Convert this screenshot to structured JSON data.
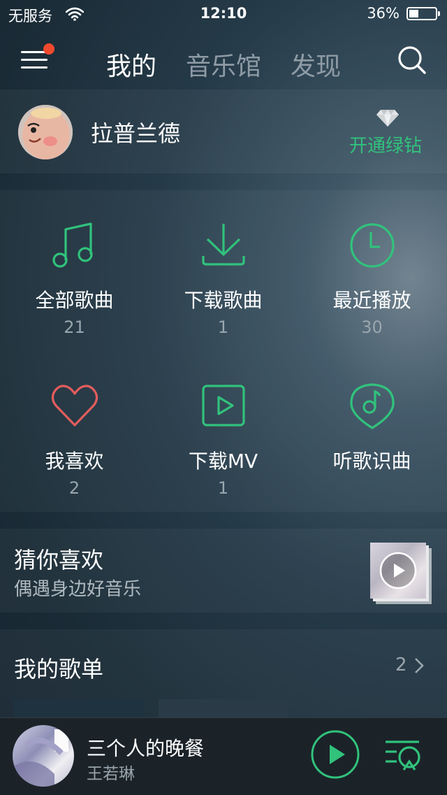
{
  "status_bar": {
    "carrier": "无服务",
    "time": "12:10",
    "battery": "36%",
    "battery_level": 0.36
  },
  "nav": {
    "tabs": [
      {
        "label": "我的",
        "active": true
      },
      {
        "label": "音乐馆",
        "active": false
      },
      {
        "label": "发现",
        "active": false
      }
    ]
  },
  "profile": {
    "username": "拉普兰德",
    "vip_label": "开通绿钻"
  },
  "grid": [
    {
      "label": "全部歌曲",
      "count": "21",
      "icon": "music-note-icon"
    },
    {
      "label": "下载歌曲",
      "count": "1",
      "icon": "download-icon"
    },
    {
      "label": "最近播放",
      "count": "30",
      "icon": "clock-icon"
    },
    {
      "label": "我喜欢",
      "count": "2",
      "icon": "heart-icon"
    },
    {
      "label": "下载MV",
      "count": "1",
      "icon": "video-icon"
    },
    {
      "label": "听歌识曲",
      "count": "",
      "icon": "music-recognition-icon"
    }
  ],
  "guess": {
    "title": "猜你喜欢",
    "subtitle": "偶遇身边好音乐"
  },
  "playlists": {
    "title": "我的歌单",
    "count": "2"
  },
  "player": {
    "song": "三个人的晚餐",
    "artist": "王若琳"
  },
  "colors": {
    "accent": "#31c27c",
    "heart": "#e25d5d",
    "notification": "#f04a2e"
  }
}
